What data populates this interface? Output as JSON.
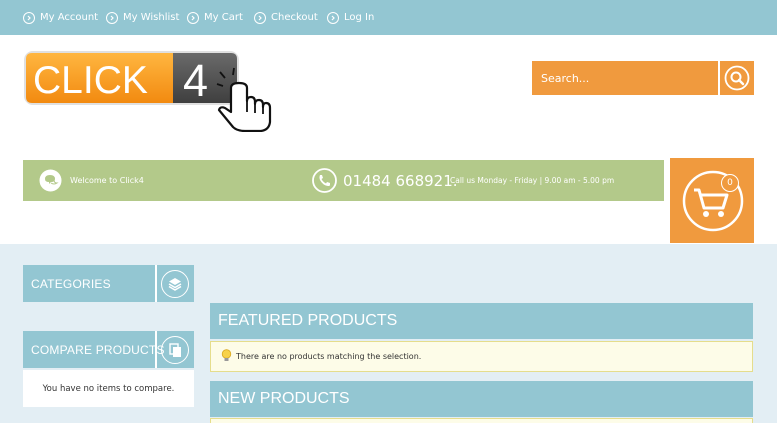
{
  "top_nav": [
    {
      "label": "My Account",
      "icon": "chevron-right-circle-icon"
    },
    {
      "label": "My Wishlist",
      "icon": "chevron-right-circle-icon"
    },
    {
      "label": "My Cart",
      "icon": "chevron-right-circle-icon"
    },
    {
      "label": "Checkout",
      "icon": "chevron-right-circle-icon"
    },
    {
      "label": "Log In",
      "icon": "chevron-right-circle-icon"
    }
  ],
  "logo": {
    "left_text": "CLICK",
    "right_text": "4"
  },
  "search": {
    "placeholder": "Search...",
    "icon": "search-icon"
  },
  "info_bar": {
    "welcome": "Welcome to Click4",
    "phone": "01484 668921.",
    "hours": "Call us Monday - Friday | 9.00 am - 5.00 pm"
  },
  "cart": {
    "count": "0",
    "icon": "shopping-cart-icon"
  },
  "sidebar": {
    "categories": {
      "title": "CATEGORIES",
      "icon": "layers-icon"
    },
    "compare": {
      "title": "COMPARE PRODUCTS",
      "icon": "copy-icon",
      "empty_text": "You have no items to compare."
    }
  },
  "main": {
    "featured": {
      "title": "FEATURED PRODUCTS",
      "notice": "There are no products matching the selection."
    },
    "new_products": {
      "title": "NEW PRODUCTS"
    }
  },
  "colors": {
    "accent_blue": "#93c6d2",
    "orange": "#f09a3e",
    "green": "#b3c98a",
    "logo_gray": "#555555"
  }
}
